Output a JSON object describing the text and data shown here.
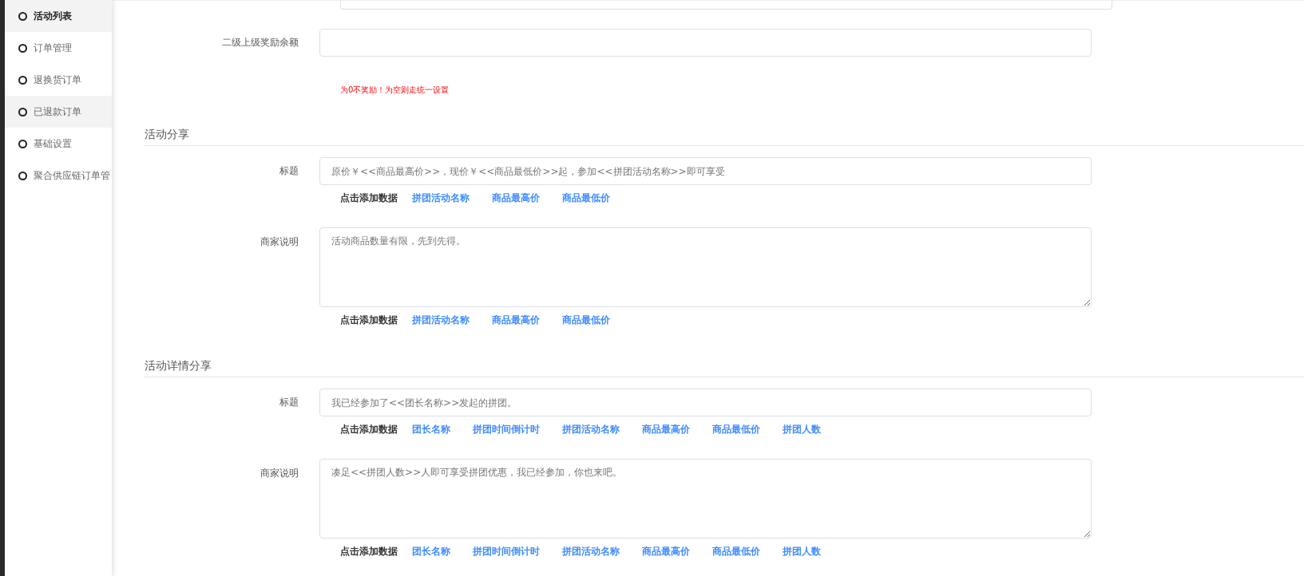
{
  "sidebar": {
    "items": [
      {
        "label": "活动列表",
        "selected": true,
        "hovered": false
      },
      {
        "label": "订单管理",
        "selected": false,
        "hovered": false
      },
      {
        "label": "退换货订单",
        "selected": false,
        "hovered": false
      },
      {
        "label": "已退款订单",
        "selected": false,
        "hovered": true
      },
      {
        "label": "基础设置",
        "selected": false,
        "hovered": false
      },
      {
        "label": "聚合供应链订单管",
        "selected": false,
        "hovered": false
      }
    ]
  },
  "reward_row": {
    "label": "二级上级奖励余额",
    "hint": "为0不奖励！为空则走统一设置"
  },
  "sections": [
    {
      "title": "活动分享",
      "fields": [
        {
          "kind": "input",
          "label": "标题",
          "placeholder": "原价￥<<商品最高价>>，现价￥<<商品最低价>>起，参加<<拼团活动名称>>即可享受",
          "insert_label": "点击添加数据",
          "tokens": [
            "拼团活动名称",
            "商品最高价",
            "商品最低价"
          ]
        },
        {
          "kind": "textarea",
          "label": "商家说明",
          "placeholder": "活动商品数量有限，先到先得。",
          "insert_label": "点击添加数据",
          "tokens": [
            "拼团活动名称",
            "商品最高价",
            "商品最低价"
          ]
        }
      ]
    },
    {
      "title": "活动详情分享",
      "fields": [
        {
          "kind": "input",
          "label": "标题",
          "placeholder": "我已经参加了<<团长名称>>发起的拼团。",
          "insert_label": "点击添加数据",
          "tokens": [
            "团长名称",
            "拼团时间倒计时",
            "拼团活动名称",
            "商品最高价",
            "商品最低价",
            "拼团人数"
          ]
        },
        {
          "kind": "textarea",
          "label": "商家说明",
          "placeholder": "凑足<<拼团人数>>人即可享受拼团优惠，我已经参加，你也来吧。",
          "insert_label": "点击添加数据",
          "tokens": [
            "团长名称",
            "拼团时间倒计时",
            "拼团活动名称",
            "商品最高价",
            "商品最低价",
            "拼团人数"
          ]
        }
      ]
    }
  ]
}
